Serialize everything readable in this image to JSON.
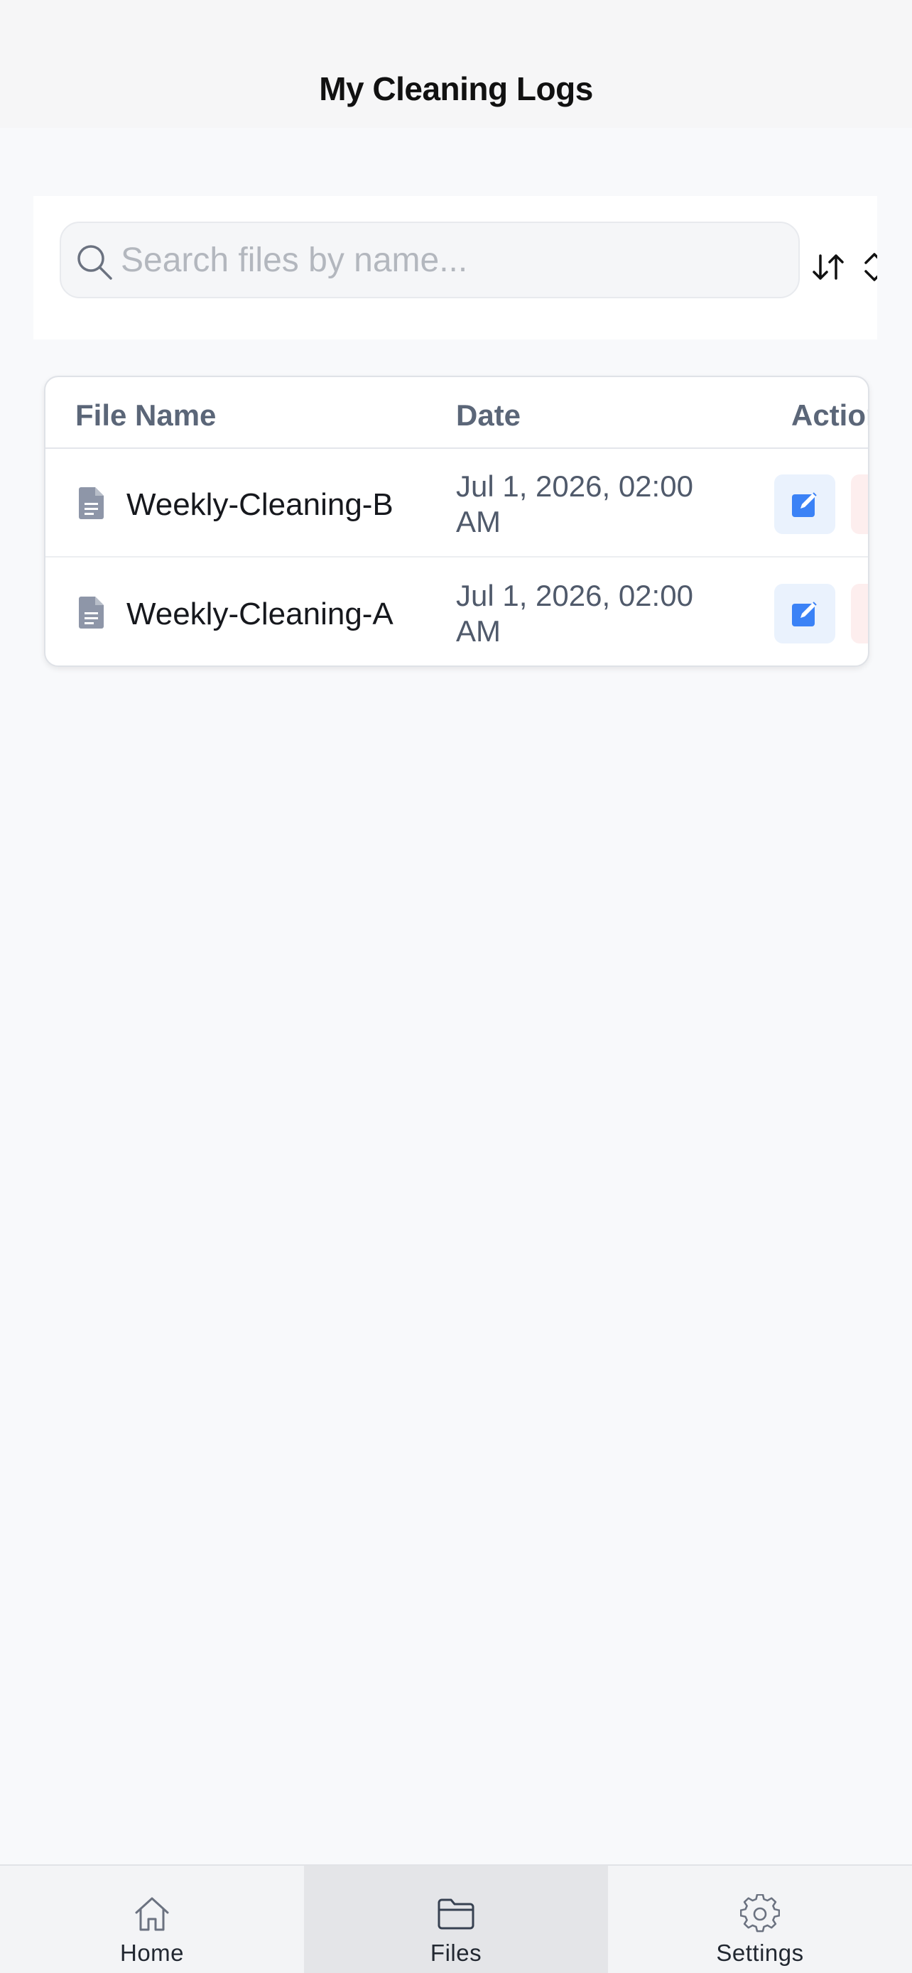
{
  "header": {
    "title": "My Cleaning Logs"
  },
  "toolbar": {
    "search_placeholder": "Search files by name...",
    "search_value": ""
  },
  "table": {
    "columns": {
      "name": "File Name",
      "date": "Date",
      "actions": "Actions"
    },
    "rows": [
      {
        "name": "Weekly-Cleaning-B",
        "date": "Jul 1, 2026, 02:00 AM"
      },
      {
        "name": "Weekly-Cleaning-A",
        "date": "Jul 1, 2026, 02:00 AM"
      }
    ]
  },
  "nav": {
    "items": [
      {
        "label": "Home",
        "icon": "home-icon",
        "active": false
      },
      {
        "label": "Files",
        "icon": "folder-icon",
        "active": true
      },
      {
        "label": "Settings",
        "icon": "gear-icon",
        "active": false
      }
    ]
  },
  "colors": {
    "accent": "#3b82f6",
    "edit_bg": "#eaf2fd",
    "delete_bg": "#fdeeee",
    "header_text": "#5b6678"
  }
}
